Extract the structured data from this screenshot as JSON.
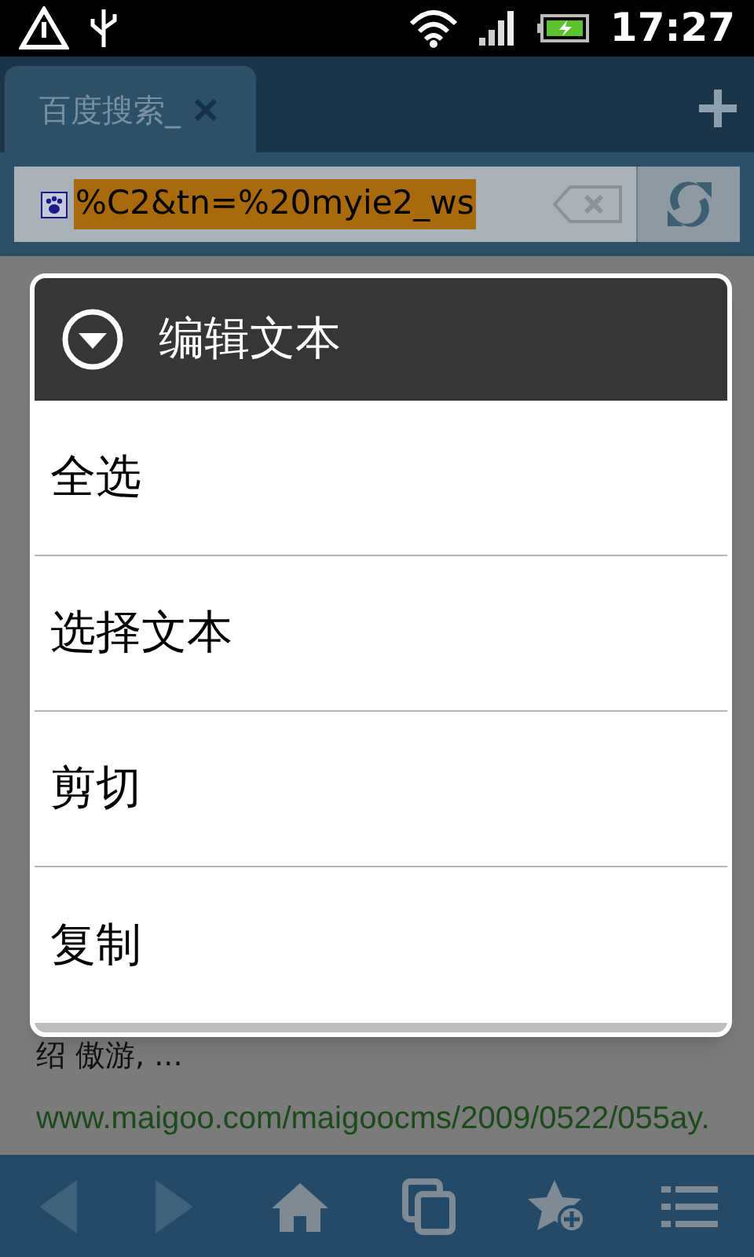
{
  "status_bar": {
    "time": "17:27"
  },
  "tabs": [
    {
      "label": "百度搜索_",
      "selected": true
    }
  ],
  "address_bar": {
    "value": "%C2&tn=%20myie2_ws",
    "highlighted": true
  },
  "page": {
    "lines": [
      {
        "kind": "text",
        "text": "绍 傲游, ..."
      },
      {
        "kind": "url",
        "text": "www.maigoo.com/maigoocms/2009/0522/055ay."
      }
    ]
  },
  "dialog": {
    "title": "编辑文本",
    "items": [
      {
        "label": "全选"
      },
      {
        "label": "选择文本"
      },
      {
        "label": "剪切"
      },
      {
        "label": "复制"
      }
    ]
  }
}
